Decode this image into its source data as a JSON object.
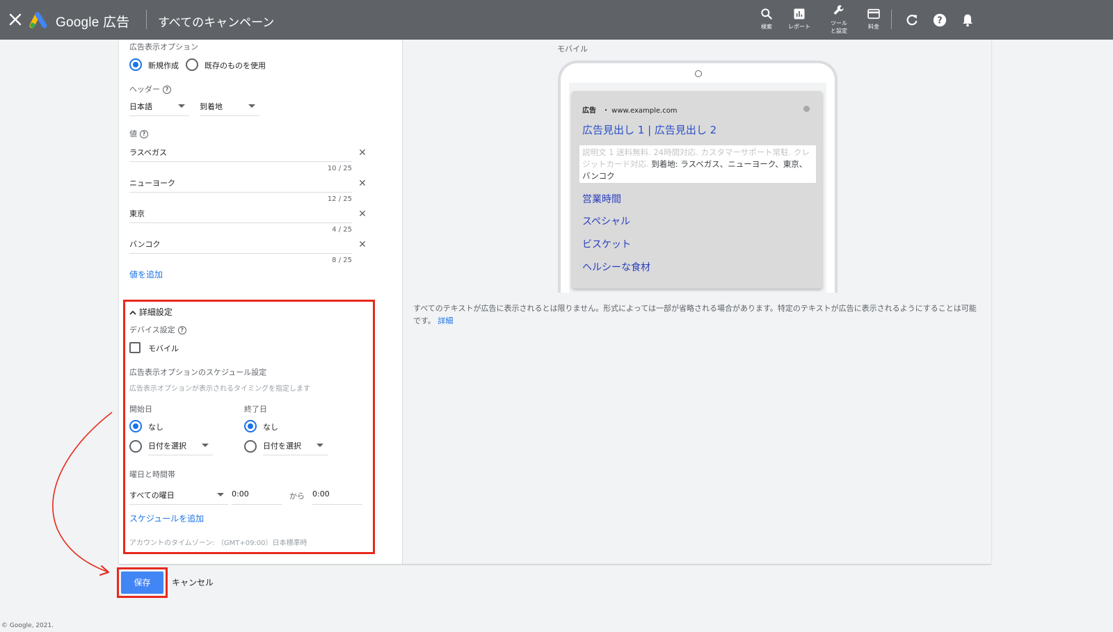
{
  "topbar": {
    "brand": "Google 広告",
    "page_title": "すべてのキャンペーン",
    "buttons": [
      {
        "label": "検索",
        "icon": "search-icon"
      },
      {
        "label": "レポート",
        "icon": "report-icon"
      },
      {
        "label": "ツールと設定",
        "icon": "wrench-icon"
      },
      {
        "label": "料金",
        "icon": "billing-icon"
      }
    ],
    "extra_icons": [
      "refresh-icon",
      "help-icon",
      "notifications-icon"
    ]
  },
  "form": {
    "ad_extension_label": "広告表示オプション",
    "create_new_label": "新規作成",
    "use_existing_label": "既存のものを使用",
    "header_label": "ヘッダー",
    "language_value": "日本語",
    "header_type_value": "到着地",
    "values_label": "値",
    "values": [
      {
        "text": "ラスベガス",
        "count": "10 / 25"
      },
      {
        "text": "ニューヨーク",
        "count": "12 / 25"
      },
      {
        "text": "東京",
        "count": "4 / 25"
      },
      {
        "text": "バンコク",
        "count": "8 / 25"
      }
    ],
    "add_value_link": "値を追加"
  },
  "advanced": {
    "toggle_label": "詳細設定",
    "device_label": "デバイス設定",
    "mobile_label": "モバイル",
    "schedule_title": "広告表示オプションのスケジュール設定",
    "schedule_hint": "広告表示オプションが表示されるタイミングを指定します",
    "start_label": "開始日",
    "end_label": "終了日",
    "none_label": "なし",
    "select_date_label": "日付を選択",
    "day_time_label": "曜日と時間帯",
    "all_days": "すべての曜日",
    "from_time": "0:00",
    "from_label": "から",
    "to_time": "0:00",
    "add_schedule_link": "スケジュールを追加",
    "timezone_text": "アカウントのタイムゾーン: （GMT+09:00）日本標準時"
  },
  "preview": {
    "device_label": "モバイル",
    "ad_badge": "広告",
    "ad_url": "・ www.example.com",
    "headline": "広告見出し 1 | 広告見出し 2",
    "desc_faded": "説明文 1 送料無料. 24時間対応. カスタマーサポート常駐. クレジットカード対応.",
    "desc_main": " 到着地: ラスベガス、ニューヨーク、東京、バンコク",
    "sitelinks": [
      "営業時間",
      "スペシャル",
      "ビスケット",
      "ヘルシーな食材"
    ],
    "note": "すべてのテキストが広告に表示されるとは限りません。形式によっては一部が省略される場合があります。特定のテキストが広告に表示されるようにすることは可能です。",
    "note_link": "詳細"
  },
  "actions": {
    "save_label": "保存",
    "cancel_label": "キャンセル"
  },
  "footer": "© Google, 2021.",
  "colors": {
    "topbar": "#5f6368",
    "accent": "#1a73e8",
    "highlight": "#e8281c",
    "save_button": "#4285f4"
  }
}
